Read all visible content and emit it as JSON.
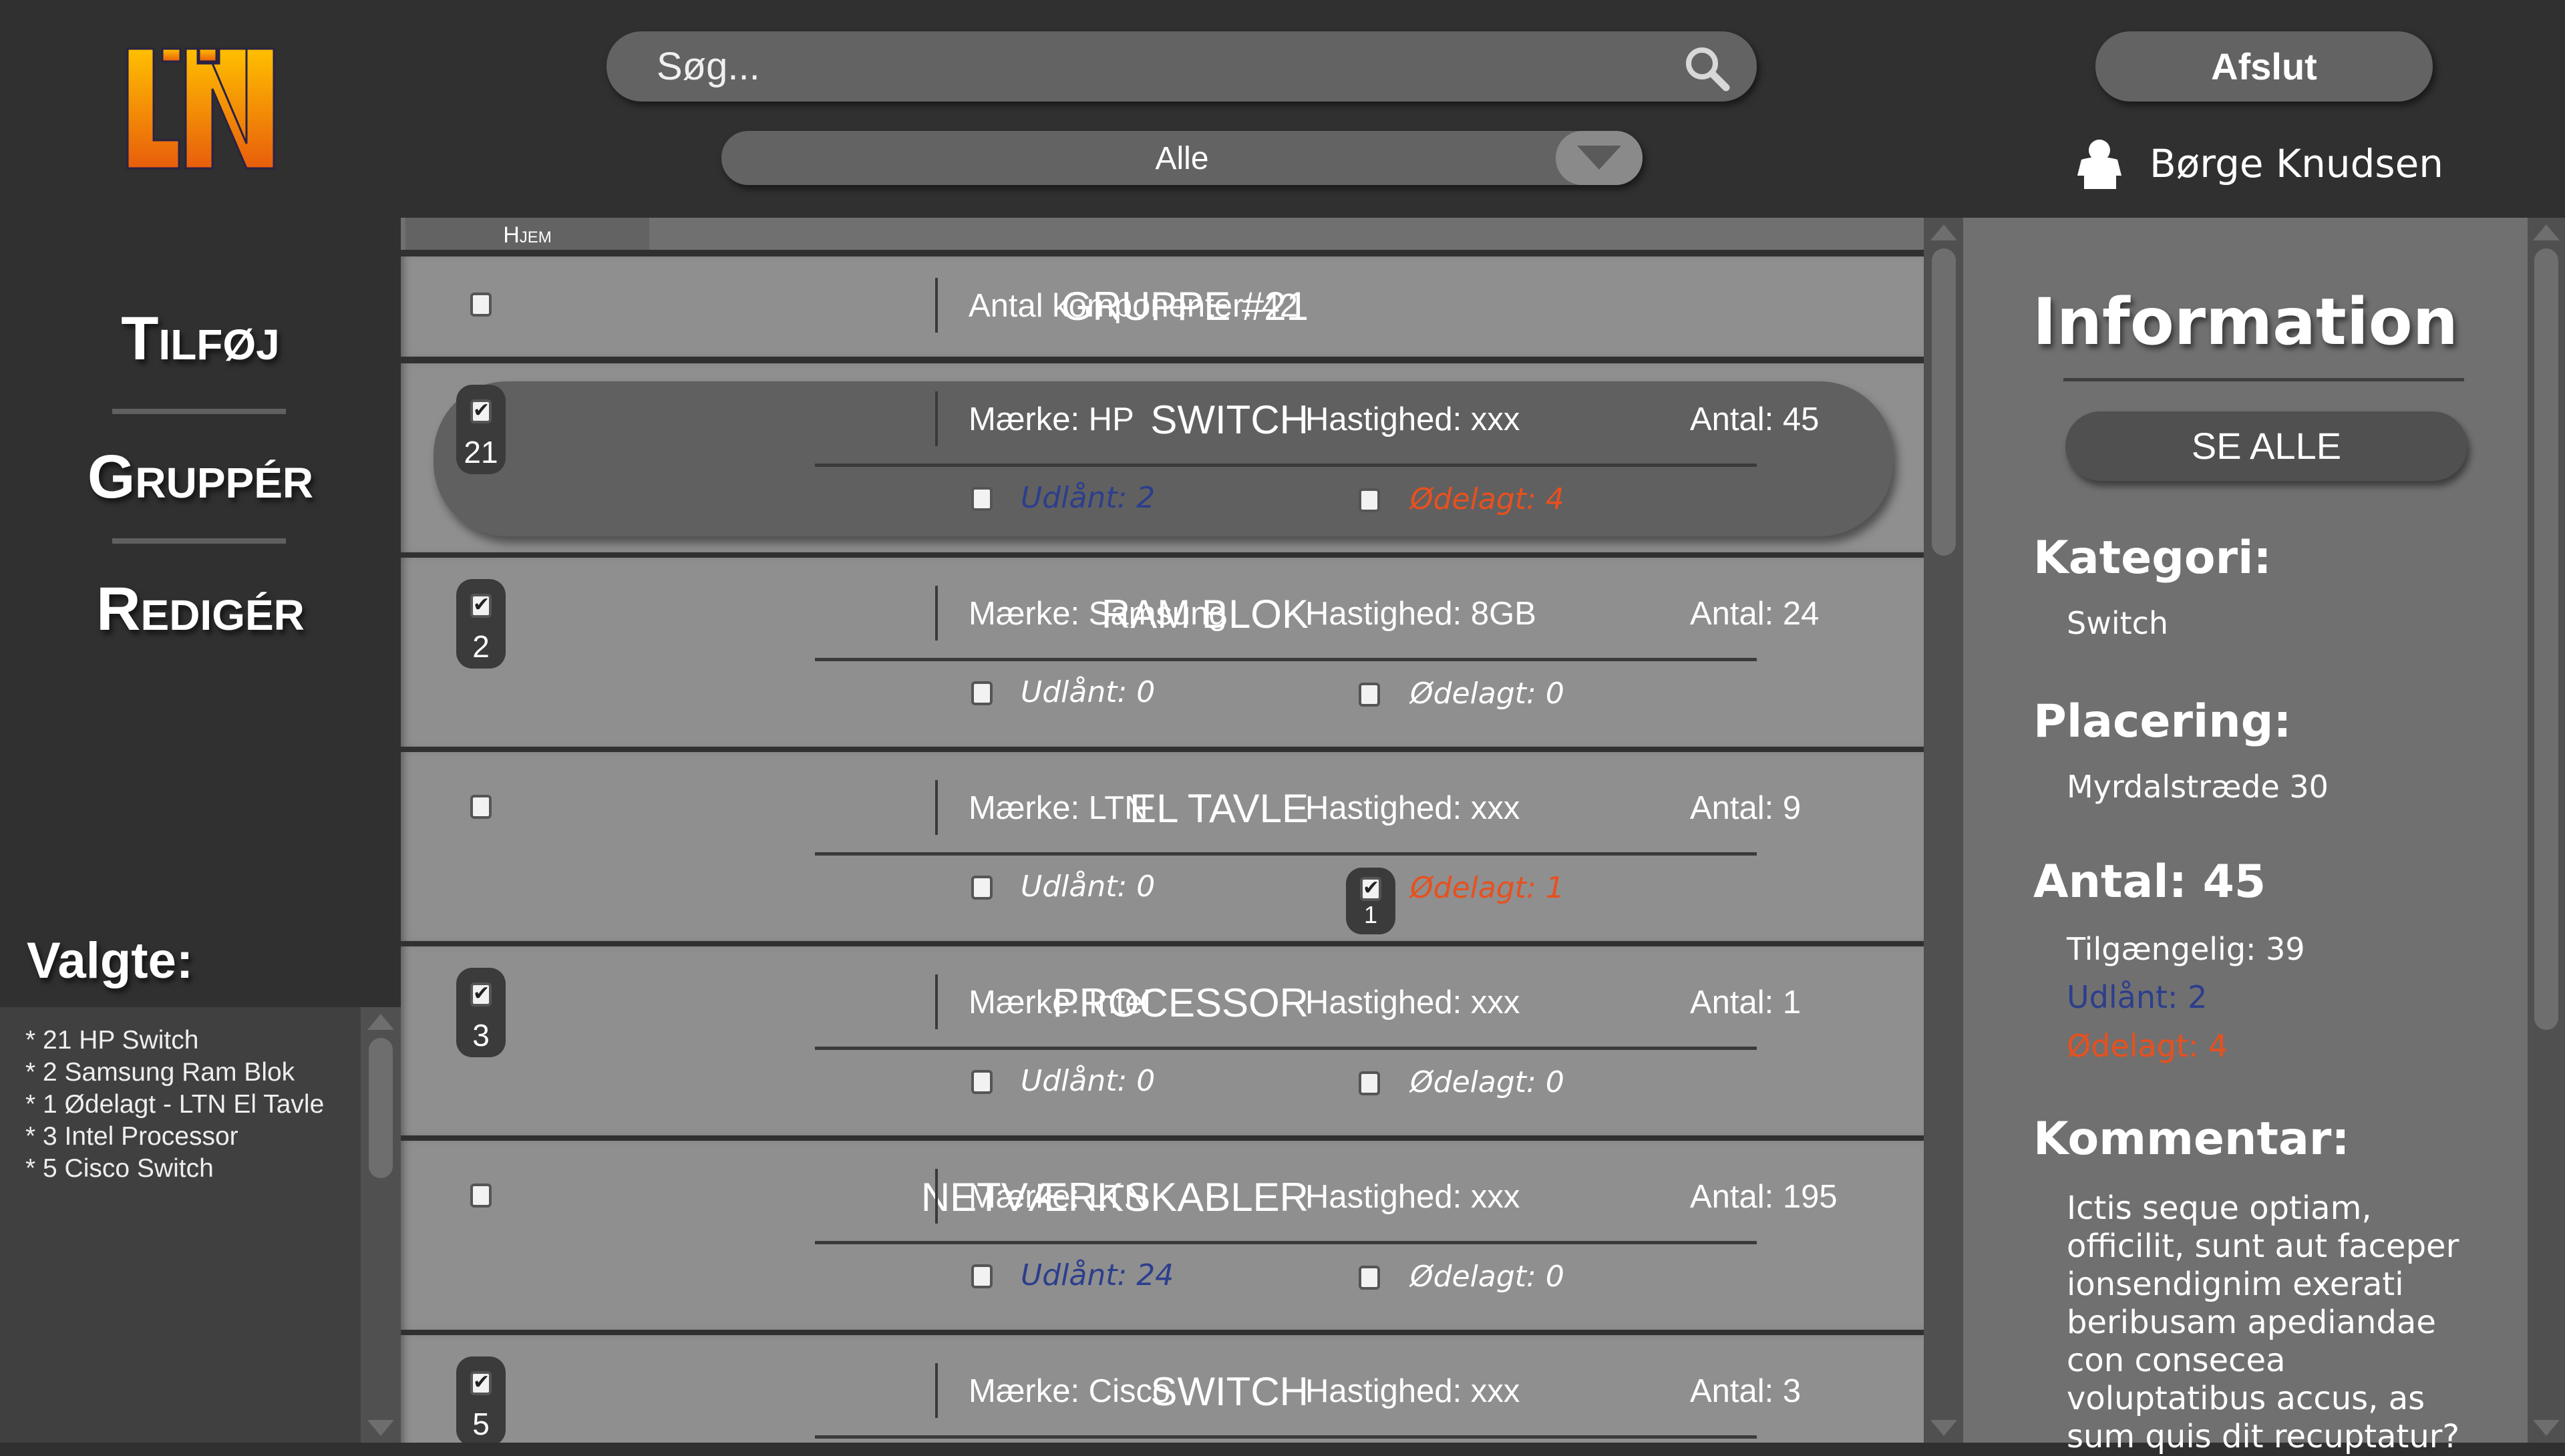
{
  "logo": {
    "text": "LTN",
    "colors": [
      "#ffc000",
      "#e85d0c"
    ]
  },
  "nav": {
    "items": [
      {
        "label": "Tilføj"
      },
      {
        "label": "Gruppér"
      },
      {
        "label": "Redigér"
      }
    ]
  },
  "search": {
    "placeholder": "Søg...",
    "value": "",
    "icon": "search-icon"
  },
  "filter": {
    "selected": "Alle"
  },
  "header": {
    "exit_label": "Afslut",
    "user_name": "Børge Knudsen"
  },
  "breadcrumb": {
    "home": "Hjem"
  },
  "colors": {
    "loaned": "#2c3e8c",
    "broken": "#e8501e"
  },
  "group": {
    "title": "GRUPPE #21",
    "count_text": "Antal komponenter: 42",
    "checked": false
  },
  "items": [
    {
      "name": "SWITCH",
      "brand": "Mærke: HP",
      "speed": "Hastighed: xxx",
      "count": "Antal: 45",
      "checked": true,
      "selected_count": "21",
      "loaned": "Udlånt: 2",
      "loaned_checked": false,
      "loaned_active": true,
      "broken": "Ødelagt: 4",
      "broken_checked": false,
      "broken_active": true,
      "highlighted": true
    },
    {
      "name": "RAM BLOK",
      "brand": "Mærke: Samsung",
      "speed": "Hastighed: 8GB",
      "count": "Antal: 24",
      "checked": true,
      "selected_count": "2",
      "loaned": "Udlånt: 0",
      "loaned_checked": false,
      "loaned_active": false,
      "broken": "Ødelagt: 0",
      "broken_checked": false,
      "broken_active": false
    },
    {
      "name": "EL TAVLE",
      "brand": "Mærke: LTN",
      "speed": "Hastighed: xxx",
      "count": "Antal: 9",
      "checked": false,
      "loaned": "Udlånt: 0",
      "loaned_checked": false,
      "loaned_active": false,
      "broken": "Ødelagt: 1",
      "broken_checked": true,
      "broken_count": "1",
      "broken_active": true
    },
    {
      "name": "PROCESSOR",
      "brand": "Mærke: Intel",
      "speed": "Hastighed: xxx",
      "count": "Antal: 1",
      "checked": true,
      "selected_count": "3",
      "loaned": "Udlånt: 0",
      "loaned_checked": false,
      "loaned_active": false,
      "broken": "Ødelagt: 0",
      "broken_checked": false,
      "broken_active": false
    },
    {
      "name": "NETVÆRKSKABLER",
      "brand": "Mærke: LTN",
      "speed": "Hastighed: xxx",
      "count": "Antal: 195",
      "checked": false,
      "loaned": "Udlånt: 24",
      "loaned_checked": false,
      "loaned_active": true,
      "broken": "Ødelagt: 0",
      "broken_checked": false,
      "broken_active": false
    },
    {
      "name": "SWITCH",
      "brand": "Mærke: Cisco",
      "speed": "Hastighed: xxx",
      "count": "Antal: 3",
      "checked": true,
      "selected_count": "5"
    }
  ],
  "selected": {
    "title": "Valgte:",
    "items": [
      "* 21 HP Switch",
      "* 2 Samsung Ram Blok",
      "* 1 Ødelagt - LTN El Tavle",
      "* 3 Intel Processor",
      "* 5 Cisco Switch"
    ]
  },
  "info": {
    "title": "Information",
    "see_all": "SE ALLE",
    "category_label": "Kategori:",
    "category": "Switch",
    "location_label": "Placering:",
    "location": "Myrdalstræde 30",
    "count_label": "Antal: 45",
    "available": "Tilgængelig: 39",
    "loaned": "Udlånt: 2",
    "broken": "Ødelagt: 4",
    "comment_label": "Kommentar:",
    "comment": "Ictis seque optiam, officilit, sunt aut faceper ionsendignim exerati beribusam apediandae con consecea voluptatibus accus, as sum quis dit recuptatur?"
  }
}
